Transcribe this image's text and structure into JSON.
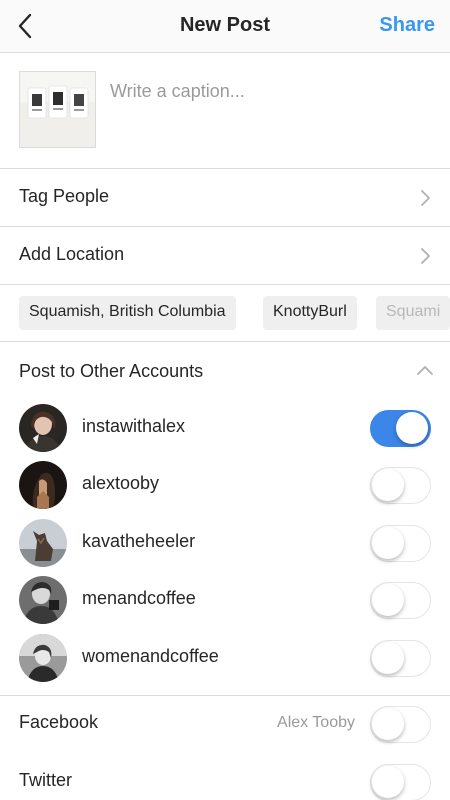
{
  "header": {
    "title": "New Post",
    "share_label": "Share"
  },
  "caption": {
    "placeholder": "Write a caption..."
  },
  "tag_people": {
    "label": "Tag People"
  },
  "add_location": {
    "label": "Add Location"
  },
  "location_suggestions": [
    "Squamish, British Columbia",
    "KnottyBurl",
    "Squami"
  ],
  "post_to_other": {
    "label": "Post to Other Accounts",
    "accounts": [
      {
        "name": "instawithalex",
        "enabled": true
      },
      {
        "name": "alextooby",
        "enabled": false
      },
      {
        "name": "kavatheheeler",
        "enabled": false
      },
      {
        "name": "menandcoffee",
        "enabled": false
      },
      {
        "name": "womenandcoffee",
        "enabled": false
      }
    ]
  },
  "share_to": {
    "facebook": {
      "label": "Facebook",
      "account": "Alex Tooby",
      "enabled": false
    },
    "twitter": {
      "label": "Twitter",
      "enabled": false
    }
  },
  "colors": {
    "accent": "#3897f0",
    "toggle_on": "#3b86e8",
    "divider": "#dbdbdb"
  }
}
